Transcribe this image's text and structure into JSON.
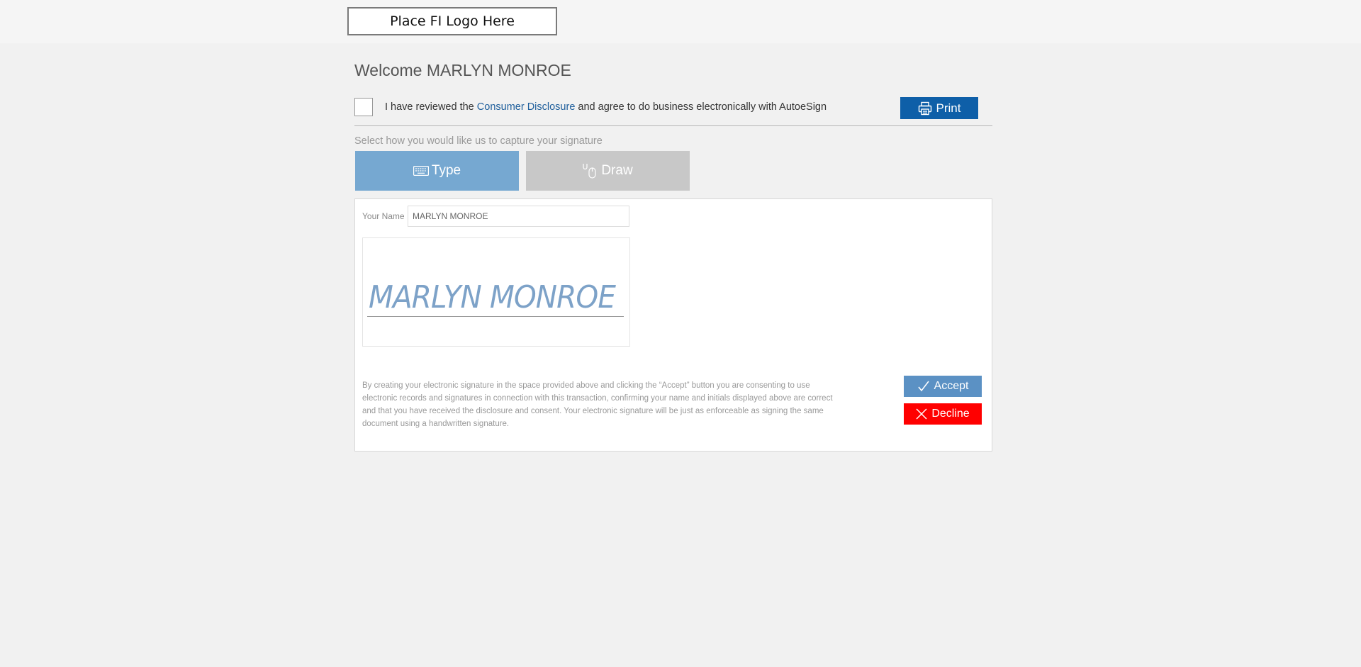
{
  "header": {
    "logo_placeholder": "Place FI Logo Here"
  },
  "welcome": {
    "text": "Welcome MARLYN MONROE"
  },
  "consent": {
    "prefix": "I have reviewed the ",
    "link_text": "Consumer Disclosure",
    "suffix": " and agree to do business electronically with AutoeSign",
    "checked": false
  },
  "print_button": {
    "label": "Print",
    "icon": "printer-icon",
    "color": "#0e5fa8"
  },
  "capture": {
    "label": "Select how you would like us to capture your signature",
    "tabs": [
      {
        "label": "Type",
        "icon": "keyboard-icon",
        "active": true,
        "color": "#76a8d1"
      },
      {
        "label": "Draw",
        "icon": "mouse-icon",
        "active": false,
        "color": "#c8c8c8"
      }
    ]
  },
  "signature_form": {
    "name_label": "Your Name",
    "name_value": "MARLYN MONROE",
    "signature_preview": "MARLYN MONROE",
    "legal_text": "By creating your electronic signature in the space provided above and clicking the “Accept” button you are consenting to use electronic records and signatures in connection with this transaction, confirming your name and initials displayed above are correct and that you have received the disclosure and consent. Your electronic signature will be just as enforceable as signing the same document using a handwritten signature."
  },
  "actions": {
    "accept_label": "Accept",
    "accept_icon": "checkmark-icon",
    "accept_color": "#5b91c4",
    "decline_label": "Decline",
    "decline_icon": "close-icon",
    "decline_color": "#ff0000"
  }
}
